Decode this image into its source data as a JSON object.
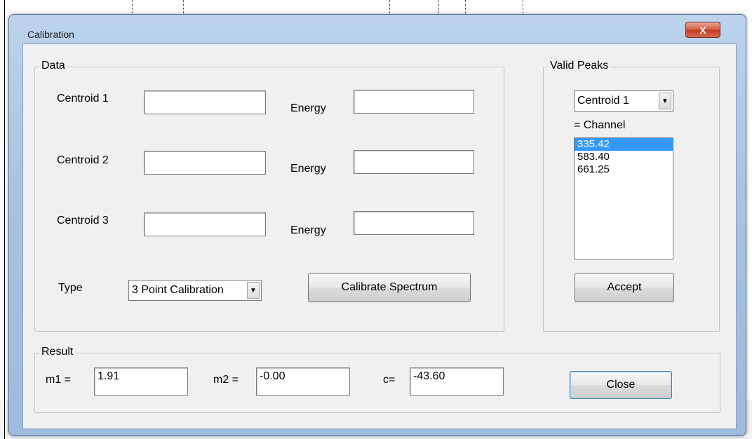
{
  "window": {
    "title": "Calibration",
    "close_glyph": "X"
  },
  "data_group": {
    "legend": "Data",
    "rows": [
      {
        "centroid_label": "Centroid 1",
        "centroid_value": "",
        "energy_label": "Energy",
        "energy_value": ""
      },
      {
        "centroid_label": "Centroid 2",
        "centroid_value": "",
        "energy_label": "Energy",
        "energy_value": ""
      },
      {
        "centroid_label": "Centroid 3",
        "centroid_value": "",
        "energy_label": "Energy",
        "energy_value": ""
      }
    ],
    "type_label": "Type",
    "type_value": "3 Point Calibration",
    "calibrate_button": "Calibrate Spectrum"
  },
  "valid_peaks": {
    "legend": "Valid Peaks",
    "centroid_select": "Centroid 1",
    "channel_label": "= Channel",
    "channels": [
      "335.42",
      "583.40",
      "661.25"
    ],
    "selected_index": 0,
    "accept_button": "Accept"
  },
  "result": {
    "legend": "Result",
    "m1_label": "m1 =",
    "m1_value": "1.91",
    "m2_label": "m2 =",
    "m2_value": "-0.00",
    "c_label": "c=",
    "c_value": "-43.60",
    "close_button": "Close"
  },
  "icons": {
    "dropdown_arrow": "▼",
    "close": "close-icon"
  },
  "colors": {
    "selection": "#3399ff",
    "close_button": "#c23a22",
    "window_frame": "#a9c4e2"
  }
}
